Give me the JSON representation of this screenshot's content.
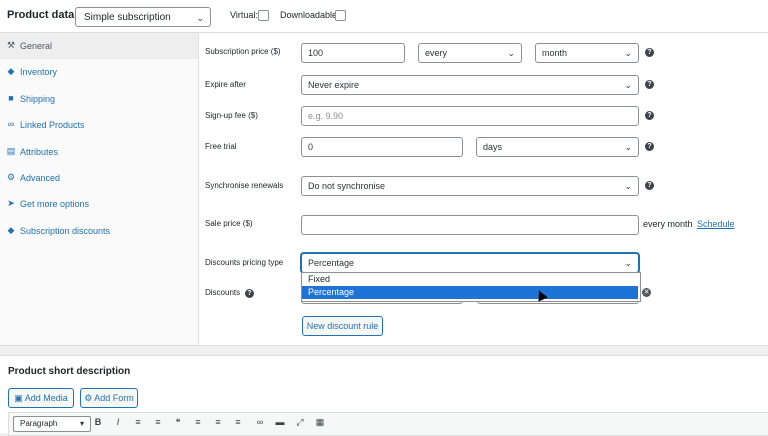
{
  "header": {
    "title": "Product data —",
    "product_type": "Simple subscription",
    "virtual_label": "Virtual:",
    "downloadable_label": "Downloadable:"
  },
  "sidebar": {
    "items": [
      {
        "label": "General",
        "icon": "wrench-icon",
        "active": true
      },
      {
        "label": "Inventory",
        "icon": "tag-icon"
      },
      {
        "label": "Shipping",
        "icon": "truck-icon"
      },
      {
        "label": "Linked Products",
        "icon": "link-icon"
      },
      {
        "label": "Attributes",
        "icon": "list-icon"
      },
      {
        "label": "Advanced",
        "icon": "gear-icon"
      },
      {
        "label": "Get more options",
        "icon": "plugin-icon"
      },
      {
        "label": "Subscription discounts",
        "icon": "tag-icon"
      }
    ]
  },
  "form": {
    "subscription_price_label": "Subscription price ($)",
    "subscription_price_value": "100",
    "interval_value": "every",
    "period_value": "month",
    "expire_label": "Expire after",
    "expire_value": "Never expire",
    "signup_label": "Sign-up fee ($)",
    "signup_placeholder": "e.g. 9.90",
    "trial_label": "Free trial",
    "trial_value": "0",
    "trial_period": "days",
    "sync_label": "Synchronise renewals",
    "sync_value": "Do not synchronise",
    "sale_label": "Sale price ($)",
    "sale_suffix": "every month",
    "schedule_link": "Schedule",
    "discount_type_label": "Discounts pricing type",
    "discount_type_value": "Percentage",
    "discount_type_options": [
      "Fixed",
      "Percentage"
    ],
    "discounts_label": "Discounts",
    "new_rule_button": "New discount rule"
  },
  "short_description": {
    "title": "Product short description",
    "add_media": "Add Media",
    "add_form": "Add Form",
    "format_select": "Paragraph"
  }
}
